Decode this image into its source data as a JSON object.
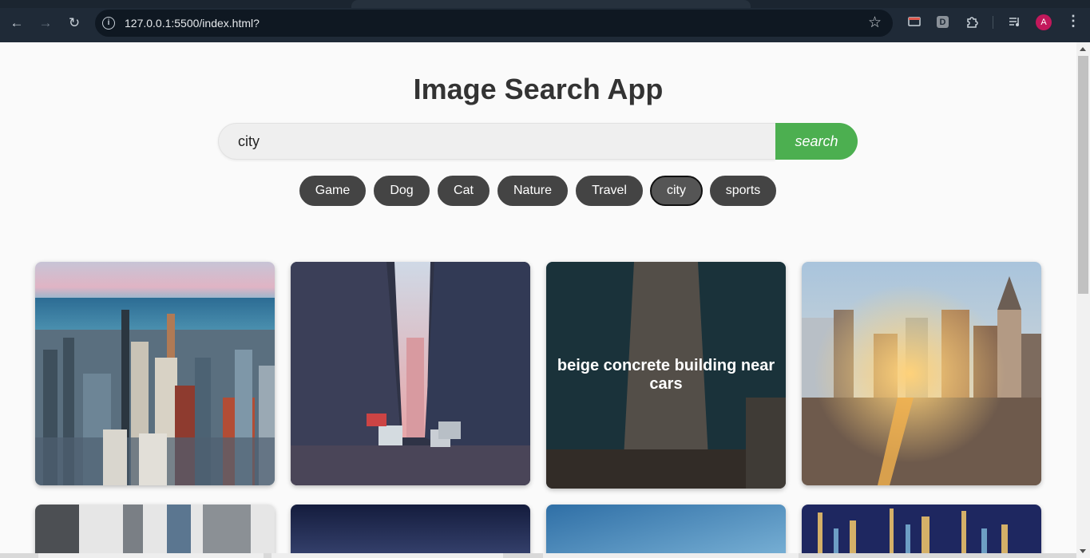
{
  "browser": {
    "url": "127.0.0.1:5500/index.html?",
    "avatar_initial": "A",
    "ext_letter": "D"
  },
  "page": {
    "title": "Image Search App",
    "search": {
      "value": "city",
      "button_label": "search"
    },
    "chips": [
      {
        "label": "Game",
        "active": false
      },
      {
        "label": "Dog",
        "active": false
      },
      {
        "label": "Cat",
        "active": false
      },
      {
        "label": "Nature",
        "active": false
      },
      {
        "label": "Travel",
        "active": false
      },
      {
        "label": "city",
        "active": true
      },
      {
        "label": "sports",
        "active": false
      }
    ],
    "results": [
      {
        "scene": "aerial-skyline-lake",
        "hover_caption": ""
      },
      {
        "scene": "downtown-street-cars",
        "hover_caption": ""
      },
      {
        "scene": "flatiron-building",
        "hover_caption": "beige concrete building near cars"
      },
      {
        "scene": "sunset-avenue-skyline",
        "hover_caption": ""
      }
    ]
  },
  "colors": {
    "accent": "#4caf50",
    "chip_bg": "#444444"
  }
}
